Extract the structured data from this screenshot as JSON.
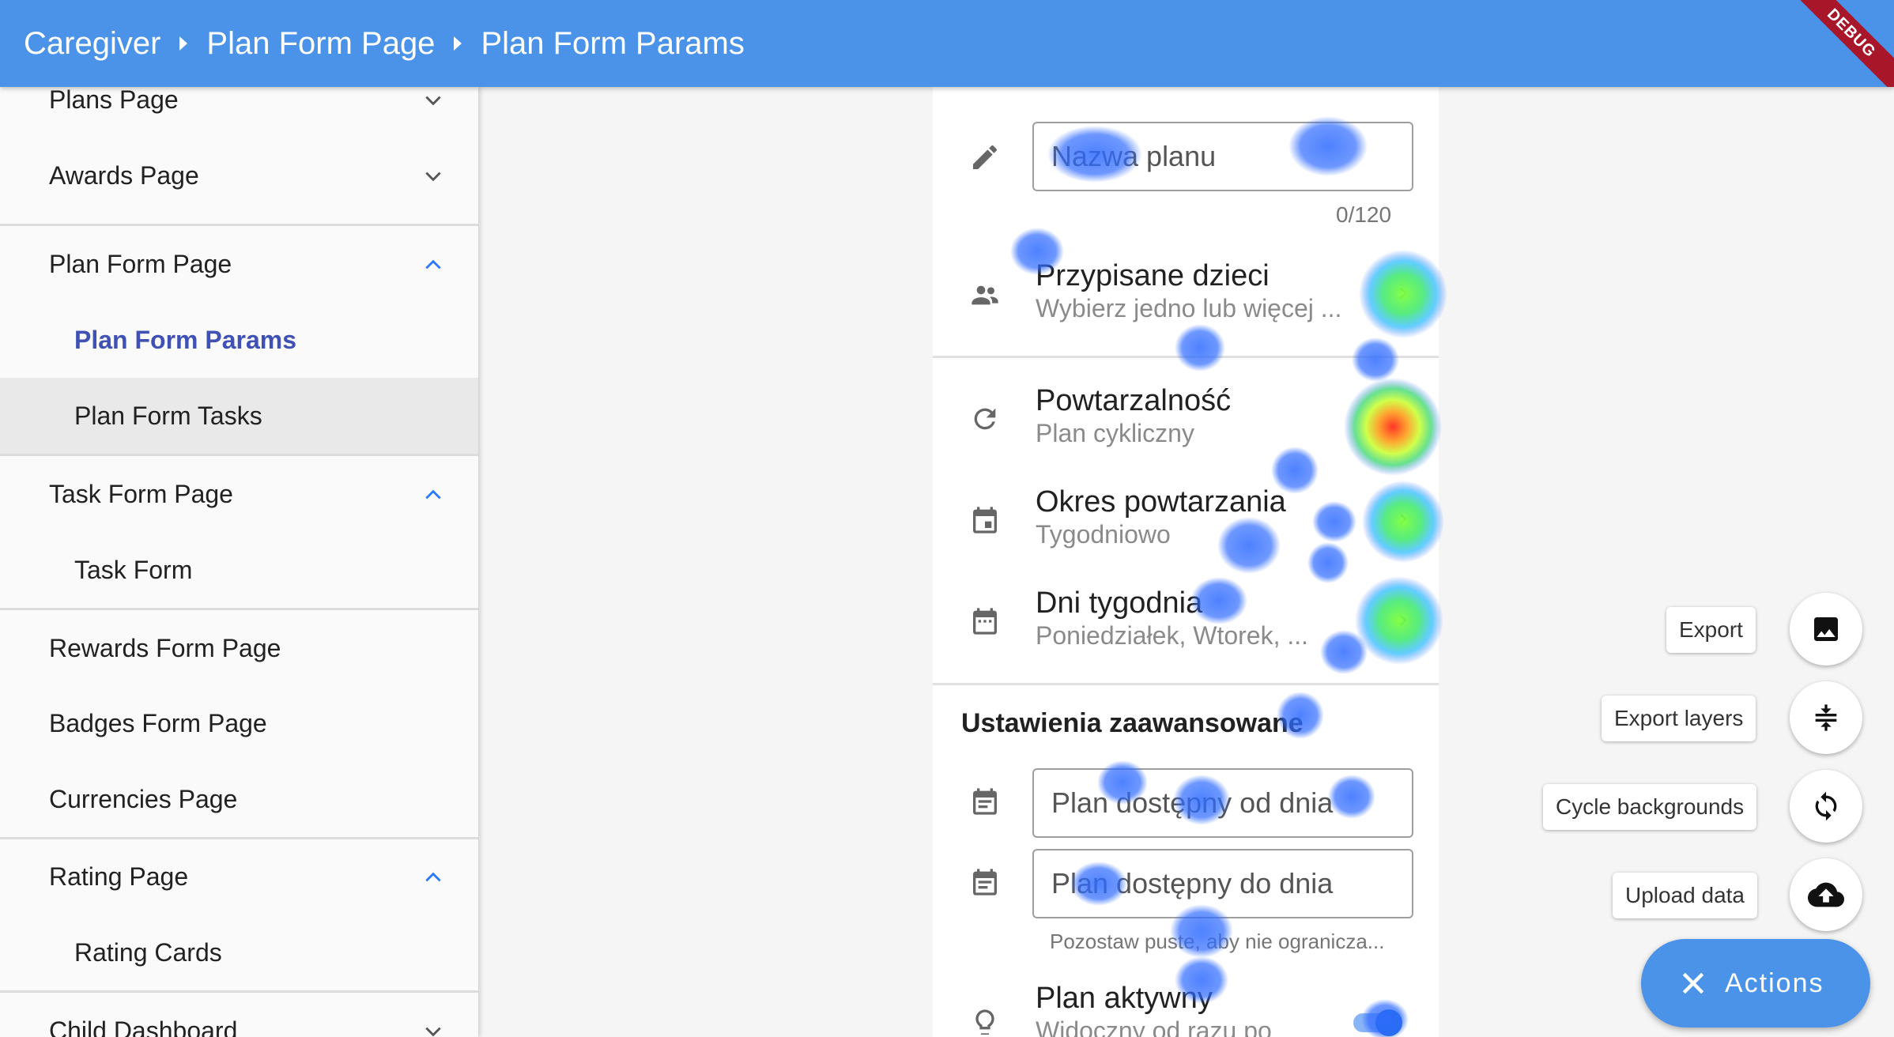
{
  "appbar": {
    "breadcrumbs": [
      "Caregiver",
      "Plan Form Page",
      "Plan Form Params"
    ],
    "debug_label": "DEBUG",
    "color": "#4a93e9"
  },
  "sidebar": {
    "items": [
      {
        "label": "Plans Page",
        "level": "top",
        "chevron": "down"
      },
      {
        "label": "Awards Page",
        "level": "top",
        "chevron": "down"
      },
      {
        "label": "Plan Form Page",
        "level": "top",
        "chevron": "up"
      },
      {
        "label": "Plan Form Params",
        "level": "sub",
        "active": true
      },
      {
        "label": "Plan Form Tasks",
        "level": "sub",
        "highlight": true
      },
      {
        "label": "Task Form Page",
        "level": "top",
        "chevron": "up"
      },
      {
        "label": "Task Form",
        "level": "sub"
      },
      {
        "label": "Rewards Form Page",
        "level": "top"
      },
      {
        "label": "Badges Form Page",
        "level": "top"
      },
      {
        "label": "Currencies Page",
        "level": "top"
      },
      {
        "label": "Rating Page",
        "level": "top",
        "chevron": "up"
      },
      {
        "label": "Rating Cards",
        "level": "sub"
      },
      {
        "label": "Child Dashboard",
        "level": "top",
        "chevron": "down"
      }
    ],
    "active_color": "#3f51b5",
    "chevron_color_up": "#2979ff"
  },
  "form": {
    "name_field": {
      "placeholder": "Nazwa planu",
      "counter": "0/120",
      "icon": "pencil-icon"
    },
    "children": {
      "title": "Przypisane dzieci",
      "subtitle": "Wybierz jedno lub więcej ...",
      "icon": "people-icon"
    },
    "repeat": {
      "title": "Powtarzalność",
      "subtitle": "Plan cykliczny",
      "icon": "refresh-icon"
    },
    "period": {
      "title": "Okres powtarzania",
      "subtitle": "Tygodniowo",
      "icon": "calendar-icon"
    },
    "weekdays": {
      "title": "Dni tygodnia",
      "subtitle": "Poniedziałek, Wtorek, ...",
      "icon": "calendar-dots-icon"
    },
    "advanced_title": "Ustawienia zaawansowane",
    "from_field": {
      "placeholder": "Plan dostępny od dnia",
      "icon": "calendar-icon"
    },
    "to_field": {
      "placeholder": "Plan dostępny do dnia",
      "icon": "calendar-icon"
    },
    "helper_text": "Pozostaw puste, aby nie ogranicza...",
    "active": {
      "title": "Plan aktywny",
      "subtitle": "Widoczny od razu po",
      "icon": "lightbulb-icon",
      "enabled": true
    }
  },
  "actions": {
    "items": [
      {
        "label": "Export",
        "icon": "image-icon"
      },
      {
        "label": "Export layers",
        "icon": "layers-compress-icon"
      },
      {
        "label": "Cycle backgrounds",
        "icon": "cycle-icon"
      },
      {
        "label": "Upload data",
        "icon": "cloud-upload-icon"
      }
    ],
    "main_label": "Actions",
    "main_icon": "close-icon"
  }
}
